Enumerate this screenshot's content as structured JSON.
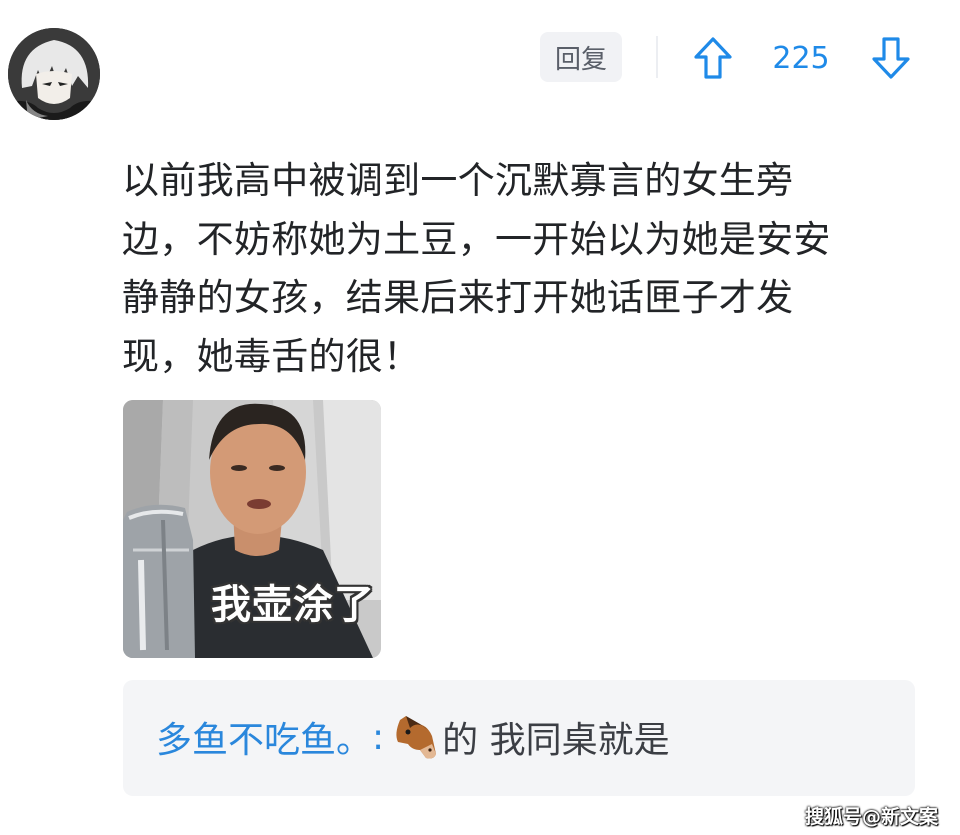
{
  "comment": {
    "actions": {
      "reply_label": "回复",
      "vote_count": "225"
    },
    "text_lines": [
      "以前我高中被调到一个沉默寡言的女生旁",
      "边，不妨称她为土豆，一开始以为她是安安",
      "静静的女孩，结果后来打开她话匣子才发",
      "现，她毒舌的很！"
    ],
    "meme": {
      "caption": "我壶涂了"
    },
    "sub_reply": {
      "username": "多鱼不吃鱼。",
      "colon": ":",
      "emoji_icon": "horse-face-icon",
      "text": "的 我同桌就是"
    }
  },
  "watermark": "搜狐号@新文案",
  "colors": {
    "accent_blue": "#1f8ae8",
    "text_primary": "#222427",
    "reply_bg": "#f1f2f5",
    "sub_reply_bg": "#f4f5f7"
  }
}
